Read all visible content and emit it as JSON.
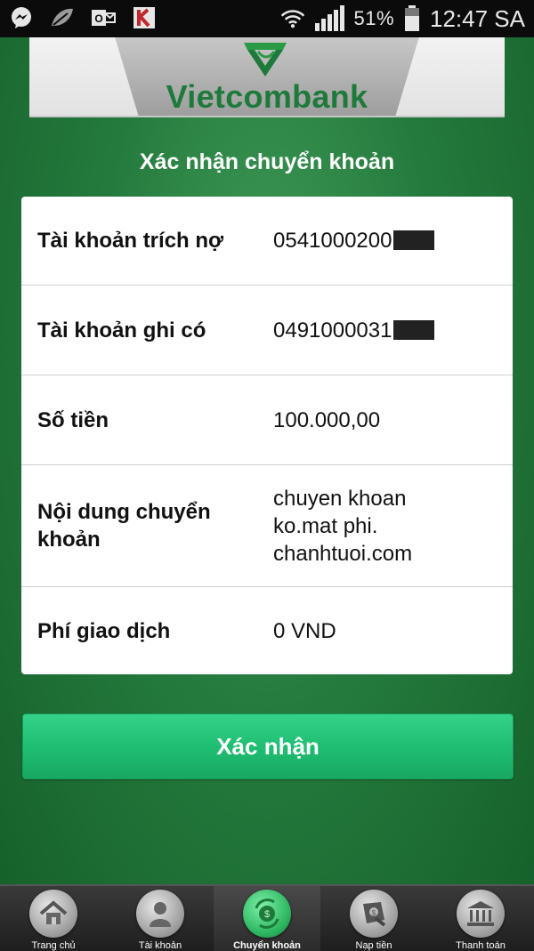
{
  "status_bar": {
    "battery": "51%",
    "time": "12:47 SA",
    "icons": [
      "messenger-icon",
      "leaf-icon",
      "outlook-icon",
      "kaspersky-icon",
      "wifi-icon",
      "signal-icon",
      "battery-icon"
    ]
  },
  "header": {
    "brand": "Vietcombank"
  },
  "page": {
    "title": "Xác nhận chuyển khoản"
  },
  "details": [
    {
      "label": "Tài khoản trích nợ",
      "value": "0541000200",
      "masked": true
    },
    {
      "label": "Tài khoản ghi có",
      "value": "0491000031",
      "masked": true
    },
    {
      "label": "Số tiền",
      "value": "100.000,00",
      "masked": false
    },
    {
      "label": "Nội dung chuyển khoản",
      "value": "chuyen khoan ko.mat phi. chanhtuoi.com",
      "masked": false
    },
    {
      "label": "Phí giao dịch",
      "value": "0 VND",
      "masked": false
    }
  ],
  "actions": {
    "confirm_label": "Xác nhận"
  },
  "bottom_nav": [
    {
      "label": "Trang chủ",
      "icon": "home-icon",
      "active": false
    },
    {
      "label": "Tài khoản",
      "icon": "user-icon",
      "active": false
    },
    {
      "label": "Chuyển khoản",
      "icon": "transfer-icon",
      "active": true
    },
    {
      "label": "Nạp tiền",
      "icon": "topup-icon",
      "active": false
    },
    {
      "label": "Thanh toán",
      "icon": "bank-icon",
      "active": false
    }
  ],
  "colors": {
    "background": "#247a3d",
    "brand_green": "#1d7a3a",
    "confirm_button": "#1fbf73"
  }
}
